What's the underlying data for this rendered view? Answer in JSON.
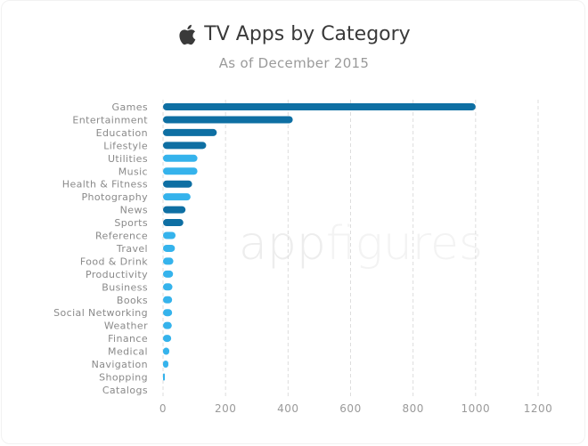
{
  "header": {
    "logo_icon": "apple-logo-icon",
    "title": "TV Apps by Category",
    "subtitle": "As of December 2015"
  },
  "watermark": {
    "bold": "app",
    "light": "figures"
  },
  "colors": {
    "dark": "#0e6fa3",
    "light": "#35b3ec",
    "grid": "#dddddd"
  },
  "chart_data": {
    "type": "bar",
    "orientation": "horizontal",
    "title": "TV Apps by Category",
    "subtitle": "As of December 2015",
    "xlabel": "",
    "ylabel": "",
    "xlim": [
      0,
      1200
    ],
    "xticks": [
      0,
      200,
      400,
      600,
      800,
      1000,
      1200
    ],
    "grid": "vertical dashed",
    "legend": "none",
    "categories": [
      "Games",
      "Entertainment",
      "Education",
      "Lifestyle",
      "Utilities",
      "Music",
      "Health & Fitness",
      "Photography",
      "News",
      "Sports",
      "Reference",
      "Travel",
      "Food & Drink",
      "Productivity",
      "Business",
      "Books",
      "Social Networking",
      "Weather",
      "Finance",
      "Medical",
      "Navigation",
      "Shopping",
      "Catalogs"
    ],
    "values": [
      1000,
      415,
      172,
      138,
      110,
      110,
      93,
      88,
      72,
      65,
      40,
      38,
      33,
      32,
      30,
      29,
      29,
      28,
      26,
      20,
      17,
      5,
      0
    ],
    "bar_shade": [
      "dark",
      "dark",
      "dark",
      "dark",
      "light",
      "light",
      "dark",
      "light",
      "dark",
      "dark",
      "light",
      "light",
      "light",
      "light",
      "light",
      "light",
      "light",
      "light",
      "light",
      "light",
      "light",
      "light",
      "light"
    ]
  }
}
